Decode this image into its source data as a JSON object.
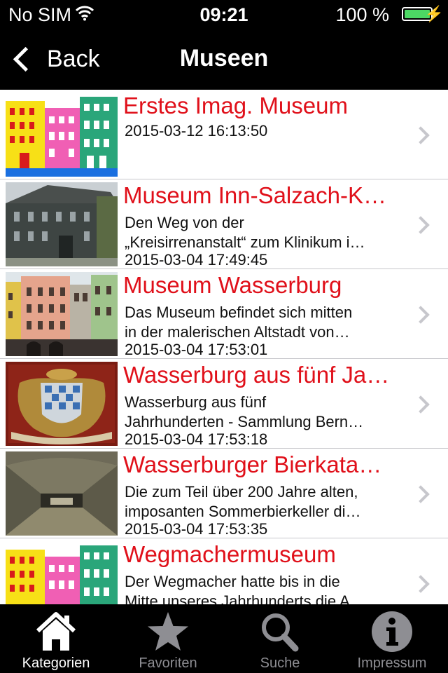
{
  "status": {
    "carrier": "No SIM",
    "time": "09:21",
    "battery": "100 %"
  },
  "nav": {
    "back_label": "Back",
    "title": "Museen"
  },
  "items": [
    {
      "title": "Erstes Imag. Museum",
      "desc1": "",
      "desc2": "",
      "date": "2015-03-12 16:13:50"
    },
    {
      "title": "Museum Inn-Salzach-K…",
      "desc1": "Den Weg von der",
      "desc2": "„Kreisirrenanstalt“ zum Klinikum i…",
      "date": "2015-03-04 17:49:45"
    },
    {
      "title": "Museum Wasserburg",
      "desc1": "Das Museum befindet sich mitten",
      "desc2": "in der malerischen Altstadt von…",
      "date": "2015-03-04 17:53:01"
    },
    {
      "title": "Wasserburg aus fünf Ja…",
      "desc1": "Wasserburg aus fünf",
      "desc2": "Jahrhunderten - Sammlung Bern…",
      "date": "2015-03-04 17:53:18"
    },
    {
      "title": "Wasserburger Bierkata…",
      "desc1": "Die zum Teil über 200 Jahre alten,",
      "desc2": "imposanten Sommerbierkeller di…",
      "date": "2015-03-04 17:53:35"
    },
    {
      "title": "Wegmachermuseum",
      "desc1": "Der Wegmacher hatte bis in die",
      "desc2": "Mitte unseres Jahrhunderts die A…",
      "date": ""
    }
  ],
  "tabs": [
    {
      "label": "Kategorien",
      "icon": "house-icon"
    },
    {
      "label": "Favoriten",
      "icon": "star-icon"
    },
    {
      "label": "Suche",
      "icon": "search-icon"
    },
    {
      "label": "Impressum",
      "icon": "info-icon"
    }
  ],
  "colors": {
    "title_red": "#e0101a",
    "battery_green": "#4cd964",
    "bar_bg": "#000000"
  }
}
